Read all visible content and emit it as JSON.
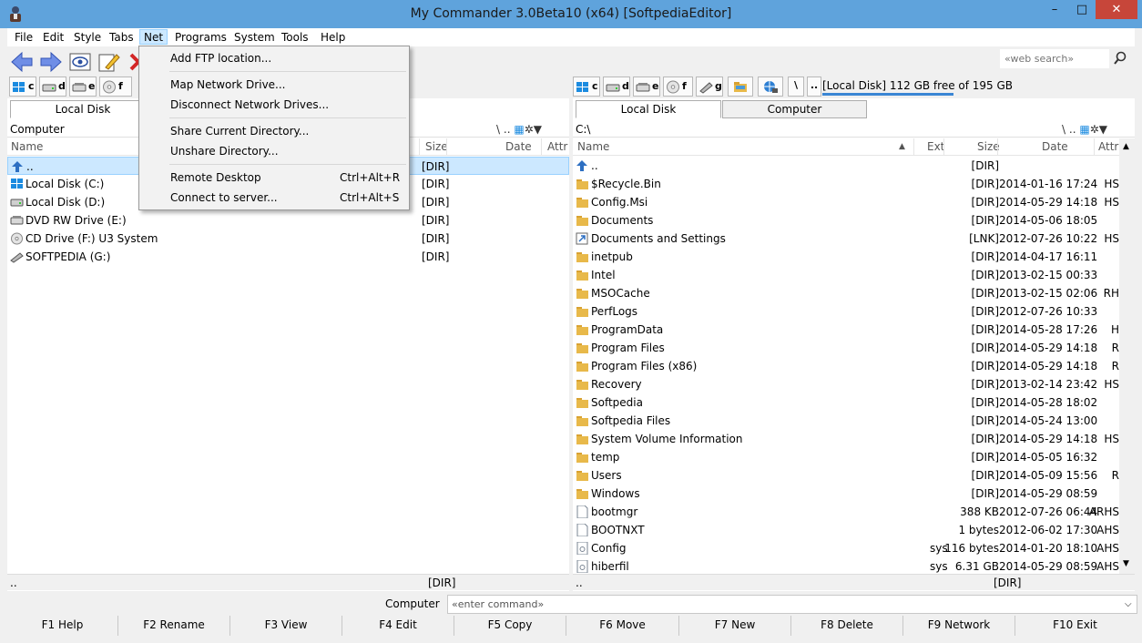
{
  "window": {
    "title": "My Commander 3.0Beta10 (x64) [SoftpediaEditor]",
    "min": "–",
    "max": "□",
    "close": "✕"
  },
  "menu": [
    "File",
    "Edit",
    "Style",
    "Tabs",
    "Net",
    "Programs",
    "System",
    "Tools",
    "Help"
  ],
  "net_menu": {
    "add_ftp": "Add FTP location...",
    "map_drive": "Map Network Drive...",
    "disconnect": "Disconnect Network Drives...",
    "share_dir": "Share Current Directory...",
    "unshare_dir": "Unshare Directory...",
    "remote_desktop": "Remote Desktop",
    "remote_desktop_sc": "Ctrl+Alt+R",
    "connect_server": "Connect to server...",
    "connect_server_sc": "Ctrl+Alt+S"
  },
  "search": {
    "placeholder": "«web search»"
  },
  "drive_letters_left": [
    "c",
    "d",
    "e",
    "f"
  ],
  "drive_letters_right": [
    "c",
    "d",
    "e",
    "f",
    "g"
  ],
  "disk_info": "[Local Disk] 112 GB free of 195 GB",
  "disk_usage_fraction": 0.43,
  "left": {
    "tab": "Local Disk",
    "path": "Computer",
    "path_icons": "\\ ..",
    "cols": {
      "name": "Name",
      "size": "Size",
      "date": "Date",
      "attr": "Attr"
    },
    "rows": [
      {
        "name": "..",
        "size": "[DIR]"
      },
      {
        "name": "Local Disk (C:)",
        "size": "[DIR]"
      },
      {
        "name": "Local Disk (D:)",
        "size": "[DIR]"
      },
      {
        "name": "DVD RW Drive (E:)",
        "size": "[DIR]"
      },
      {
        "name": "CD Drive (F:) U3 System",
        "size": "[DIR]"
      },
      {
        "name": "SOFTPEDIA (G:)",
        "size": "[DIR]"
      }
    ],
    "status_name": "..",
    "status_size": "[DIR]"
  },
  "right": {
    "tab_local": "Local Disk",
    "tab_computer": "Computer",
    "path": "C:\\",
    "path_icons": "\\ ..",
    "cols": {
      "name": "Name",
      "ext": "Ext",
      "size": "Size",
      "date": "Date",
      "attr": "Attr"
    },
    "rows": [
      {
        "name": "..",
        "ext": "",
        "size": "[DIR]",
        "date": "",
        "attr": "",
        "type": "up"
      },
      {
        "name": "$Recycle.Bin",
        "ext": "",
        "size": "[DIR]",
        "date": "2014-01-16 17:24",
        "attr": "HS",
        "type": "folder"
      },
      {
        "name": "Config.Msi",
        "ext": "",
        "size": "[DIR]",
        "date": "2014-05-29 14:18",
        "attr": "HS",
        "type": "folder"
      },
      {
        "name": "Documents",
        "ext": "",
        "size": "[DIR]",
        "date": "2014-05-06 18:05",
        "attr": "",
        "type": "folder"
      },
      {
        "name": "Documents and Settings",
        "ext": "",
        "size": "[LNK]",
        "date": "2012-07-26 10:22",
        "attr": "HS",
        "type": "link"
      },
      {
        "name": "inetpub",
        "ext": "",
        "size": "[DIR]",
        "date": "2014-04-17 16:11",
        "attr": "",
        "type": "folder"
      },
      {
        "name": "Intel",
        "ext": "",
        "size": "[DIR]",
        "date": "2013-02-15 00:33",
        "attr": "",
        "type": "folder"
      },
      {
        "name": "MSOCache",
        "ext": "",
        "size": "[DIR]",
        "date": "2013-02-15 02:06",
        "attr": "RH",
        "type": "folder"
      },
      {
        "name": "PerfLogs",
        "ext": "",
        "size": "[DIR]",
        "date": "2012-07-26 10:33",
        "attr": "",
        "type": "folder"
      },
      {
        "name": "ProgramData",
        "ext": "",
        "size": "[DIR]",
        "date": "2014-05-28 17:26",
        "attr": "H",
        "type": "folder"
      },
      {
        "name": "Program Files",
        "ext": "",
        "size": "[DIR]",
        "date": "2014-05-29 14:18",
        "attr": "R",
        "type": "folder"
      },
      {
        "name": "Program Files (x86)",
        "ext": "",
        "size": "[DIR]",
        "date": "2014-05-29 14:18",
        "attr": "R",
        "type": "folder"
      },
      {
        "name": "Recovery",
        "ext": "",
        "size": "[DIR]",
        "date": "2013-02-14 23:42",
        "attr": "HS",
        "type": "folder"
      },
      {
        "name": "Softpedia",
        "ext": "",
        "size": "[DIR]",
        "date": "2014-05-28 18:02",
        "attr": "",
        "type": "folder"
      },
      {
        "name": "Softpedia Files",
        "ext": "",
        "size": "[DIR]",
        "date": "2014-05-24 13:00",
        "attr": "",
        "type": "folder"
      },
      {
        "name": "System Volume Information",
        "ext": "",
        "size": "[DIR]",
        "date": "2014-05-29 14:18",
        "attr": "HS",
        "type": "folder"
      },
      {
        "name": "temp",
        "ext": "",
        "size": "[DIR]",
        "date": "2014-05-05 16:32",
        "attr": "",
        "type": "folder"
      },
      {
        "name": "Users",
        "ext": "",
        "size": "[DIR]",
        "date": "2014-05-09 15:56",
        "attr": "R",
        "type": "folder"
      },
      {
        "name": "Windows",
        "ext": "",
        "size": "[DIR]",
        "date": "2014-05-29 08:59",
        "attr": "",
        "type": "folder"
      },
      {
        "name": "bootmgr",
        "ext": "",
        "size": "388 KB",
        "date": "2012-07-26 06:44",
        "attr": "ARHS",
        "type": "file"
      },
      {
        "name": "BOOTNXT",
        "ext": "",
        "size": "1 bytes",
        "date": "2012-06-02 17:30",
        "attr": "AHS",
        "type": "file"
      },
      {
        "name": "Config",
        "ext": "sys",
        "size": "116 bytes",
        "date": "2014-01-20 18:10",
        "attr": "AHS",
        "type": "sys"
      },
      {
        "name": "hiberfil",
        "ext": "sys",
        "size": "6.31 GB",
        "date": "2014-05-29 08:59",
        "attr": "AHS",
        "type": "sys"
      }
    ],
    "status_name": "..",
    "status_size": "[DIR]"
  },
  "command": {
    "label": "Computer",
    "placeholder": "«enter command»"
  },
  "fkeys": [
    "F1 Help",
    "F2 Rename",
    "F3 View",
    "F4 Edit",
    "F5 Copy",
    "F6 Move",
    "F7 New",
    "F8 Delete",
    "F9 Network",
    "F10 Exit"
  ]
}
